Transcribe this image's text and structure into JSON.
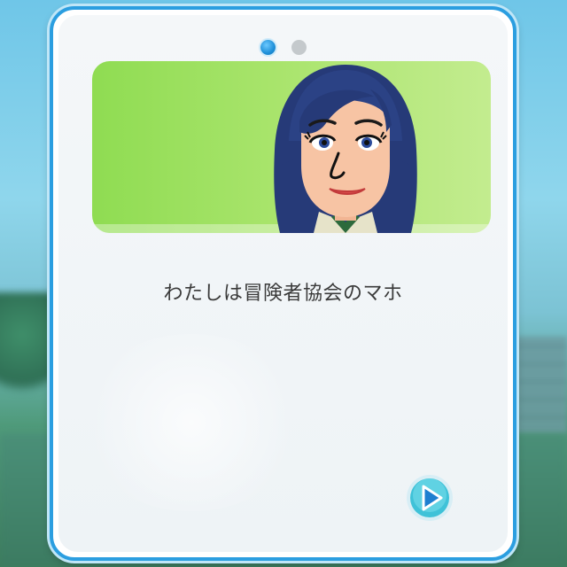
{
  "dialog": {
    "page_indicator": {
      "current": 1,
      "total": 2
    },
    "speaker_portrait": "mii-avatar-woman-dark-hair",
    "message": "わたしは冒険者協会のマホ",
    "next_button_icon": "play-triangle-icon"
  },
  "colors": {
    "card_border": "#2b9ee0",
    "banner_green": "#a8e46b",
    "active_dot": "#1e8fd8",
    "inactive_dot": "#c4c9cc",
    "next_button": "#3fc2d8"
  }
}
